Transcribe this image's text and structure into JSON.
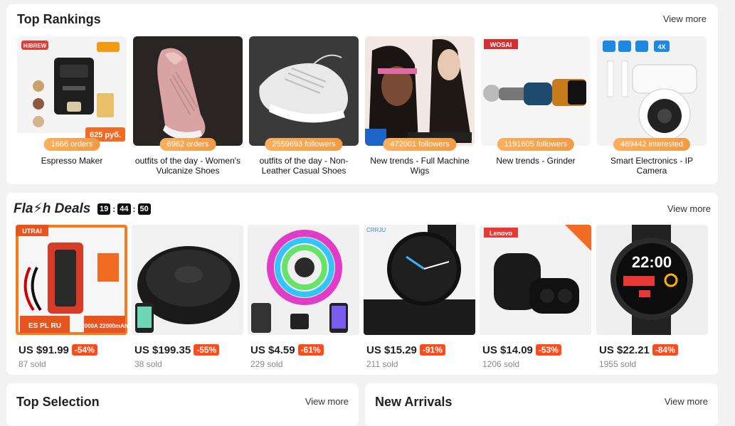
{
  "top_rankings": {
    "title": "Top Rankings",
    "view_more": "View more",
    "items": [
      {
        "name": "Espresso Maker",
        "stat": "1666 orders",
        "img_brand": "HiBREW",
        "img_badge": "625 руб."
      },
      {
        "name": "outfits of the day - Women's Vulcanize Shoes",
        "stat": "6962 orders"
      },
      {
        "name": "outfits of the day - Non-Leather Casual Shoes",
        "stat": "2559693 followers"
      },
      {
        "name": "New trends - Full Machine Wigs",
        "stat": "472001 followers"
      },
      {
        "name": "New trends - Grinder",
        "stat": "1191605 followers",
        "img_brand": "WOSAI"
      },
      {
        "name": "Smart Electronics - IP Camera",
        "stat": "489442 interested",
        "img_badge": "4X"
      }
    ]
  },
  "flash_deals": {
    "title": "Fla⚡h Deals",
    "timer": {
      "h": "19",
      "m": "44",
      "s": "50"
    },
    "view_more": "View more",
    "items": [
      {
        "price": "US $91.99",
        "discount": "-54%",
        "sold": "87 sold",
        "img_brand": "UTRAI",
        "img_caption": "2000A 22000mAh",
        "img_badge": "ES PL RU"
      },
      {
        "price": "US $199.35",
        "discount": "-55%",
        "sold": "38 sold"
      },
      {
        "price": "US $4.59",
        "discount": "-61%",
        "sold": "229 sold"
      },
      {
        "price": "US $15.29",
        "discount": "-91%",
        "sold": "211 sold",
        "img_brand": "CRRJU"
      },
      {
        "price": "US $14.09",
        "discount": "-53%",
        "sold": "1206 sold",
        "img_brand": "Lenovo"
      },
      {
        "price": "US $22.21",
        "discount": "-84%",
        "sold": "1955 sold",
        "img_caption": "22:00"
      }
    ]
  },
  "top_selection": {
    "title": "Top Selection",
    "view_more": "View more"
  },
  "new_arrivals": {
    "title": "New Arrivals",
    "view_more": "View more"
  },
  "colors": {
    "accent": "#fd4b1c",
    "pill": "#f6a04a"
  }
}
